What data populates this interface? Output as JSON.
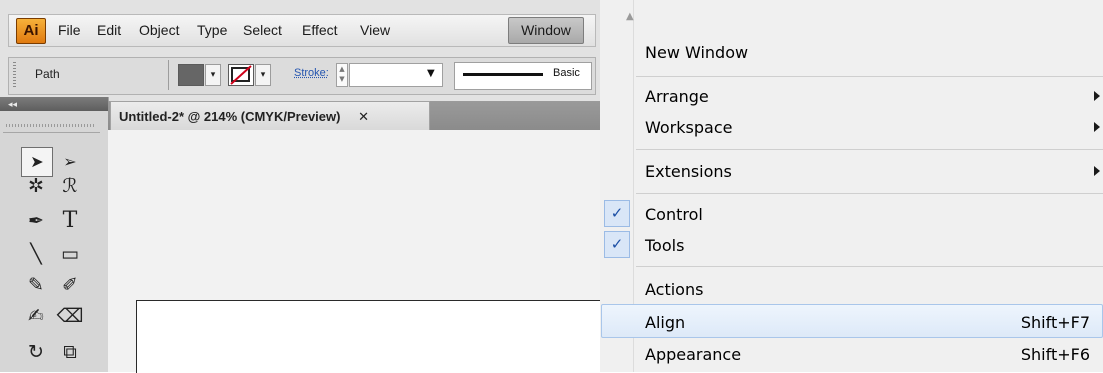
{
  "app": {
    "logo": "Ai",
    "menus": [
      "File",
      "Edit",
      "Object",
      "Type",
      "Select",
      "Effect",
      "View",
      "Window"
    ]
  },
  "controlbar": {
    "selection_label": "Path",
    "stroke_label": "Stroke:",
    "brush_label": "Basic",
    "fill_color": "#666666"
  },
  "document": {
    "tab_title": "Untitled-2* @ 214% (CMYK/Preview)",
    "close_glyph": "✕"
  },
  "tools": {
    "icons": [
      "selection-tool-icon",
      "direct-selection-tool-icon",
      "magic-wand-tool-icon",
      "lasso-tool-icon",
      "pen-tool-icon",
      "type-tool-icon",
      "line-segment-tool-icon",
      "rectangle-tool-icon",
      "paintbrush-tool-icon",
      "pencil-tool-icon",
      "blob-brush-tool-icon",
      "eraser-tool-icon",
      "rotate-tool-icon",
      "scale-tool-icon"
    ]
  },
  "window_menu": {
    "items": [
      {
        "label": "New Window"
      },
      {
        "label": "Arrange",
        "submenu": true
      },
      {
        "label": "Workspace",
        "submenu": true
      },
      {
        "label": "Extensions",
        "submenu": true
      },
      {
        "label": "Control",
        "checked": true
      },
      {
        "label": "Tools",
        "checked": true
      },
      {
        "label": "Actions"
      },
      {
        "label": "Align",
        "shortcut": "Shift+F7",
        "highlighted": true
      },
      {
        "label": "Appearance",
        "shortcut": "Shift+F6"
      }
    ],
    "check_glyph": "✓"
  },
  "colors": {
    "accent_highlight": "#dde9f8",
    "check_color": "#1c4fa5",
    "logo_orange": "#e07a10"
  }
}
